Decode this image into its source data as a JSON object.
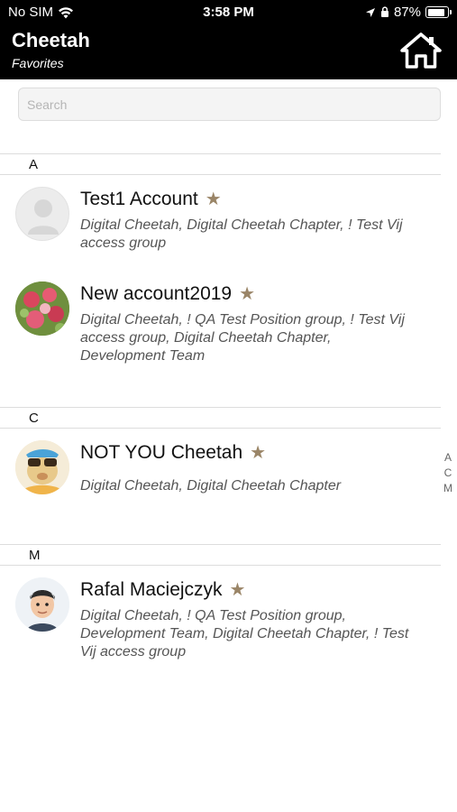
{
  "status_bar": {
    "carrier": "No SIM",
    "time": "3:58 PM",
    "battery": "87%"
  },
  "header": {
    "title": "Cheetah",
    "subtitle": "Favorites"
  },
  "search": {
    "placeholder": "Search"
  },
  "sections": [
    {
      "letter": "A",
      "contacts": [
        {
          "name": "Test1 Account",
          "groups": "Digital Cheetah, Digital Cheetah Chapter, ! Test Vij access group",
          "favorite": true
        },
        {
          "name": "New account2019",
          "groups": "Digital Cheetah, ! QA Test Position group, ! Test Vij access group, Digital Cheetah Chapter, Development Team",
          "favorite": true
        }
      ]
    },
    {
      "letter": "C",
      "contacts": [
        {
          "name": "NOT YOU Cheetah",
          "groups": "Digital Cheetah, Digital Cheetah Chapter",
          "favorite": true
        }
      ]
    },
    {
      "letter": "M",
      "contacts": [
        {
          "name": "Rafal Maciejczyk",
          "groups": "Digital Cheetah, ! QA Test Position group, Development Team, Digital Cheetah Chapter, ! Test Vij access group",
          "favorite": true
        }
      ]
    }
  ],
  "index_letters": [
    "A",
    "C",
    "M"
  ],
  "icons": {
    "star": "star-icon",
    "home": "home-icon",
    "wifi": "wifi-icon",
    "location": "location-arrow-icon",
    "lock": "lock-icon"
  },
  "colors": {
    "header_bg": "#000000",
    "star": "#9a8567",
    "group_text": "#555555"
  }
}
